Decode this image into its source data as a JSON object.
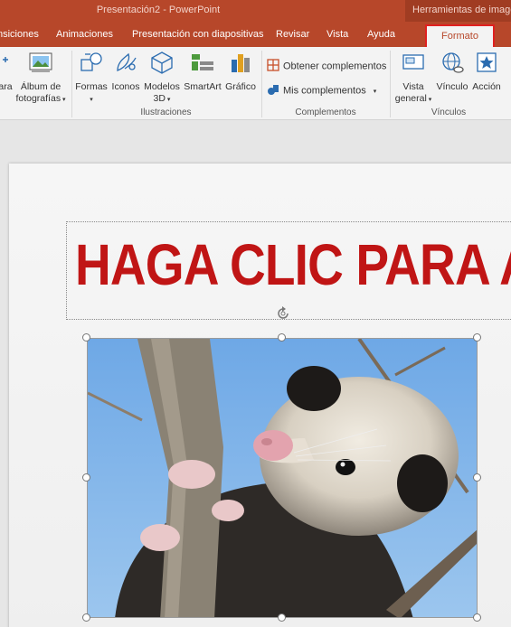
{
  "titlebar": {
    "document_title": "Presentación2 - PowerPoint",
    "contextual_tools": "Herramientas de imagen"
  },
  "tabs": [
    {
      "label": "nsiciones"
    },
    {
      "label": "Animaciones"
    },
    {
      "label": "Presentación con diapositivas"
    },
    {
      "label": "Revisar"
    },
    {
      "label": "Vista"
    },
    {
      "label": "Ayuda"
    },
    {
      "label": "Formato",
      "active": true
    }
  ],
  "ribbon": {
    "imagenes": {
      "partial_label": "ara",
      "album_label_1": "Álbum de",
      "album_label_2": "fotografías"
    },
    "ilustraciones": {
      "formas": "Formas",
      "iconos": "Iconos",
      "modelos_1": "Modelos",
      "modelos_2": "3D",
      "smartart": "SmartArt",
      "grafico": "Gráfico",
      "group_label": "Ilustraciones"
    },
    "complementos": {
      "obtener": "Obtener complementos",
      "mis": "Mis complementos",
      "group_label": "Complementos"
    },
    "vinculos": {
      "vista_1": "Vista",
      "vista_2": "general",
      "vinculo": "Vínculo",
      "accion": "Acción",
      "group_label": "Vínculos"
    }
  },
  "slide": {
    "title_placeholder": "HAGA CLIC PARA AGREGAR TÍTULO"
  },
  "colors": {
    "accent": "#b7472a",
    "title_red": "#c01515",
    "highlight": "#e02020"
  }
}
